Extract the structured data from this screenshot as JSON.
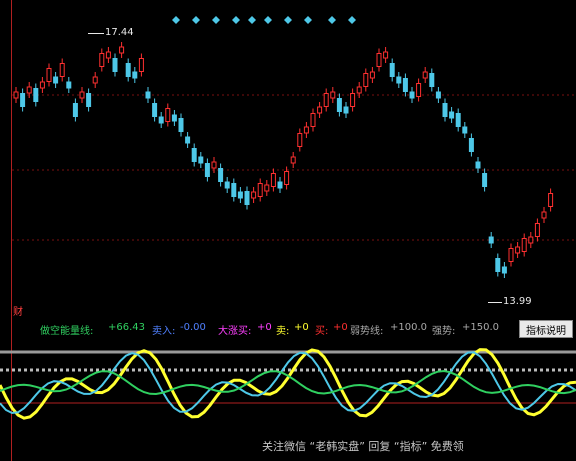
{
  "price_chart": {
    "high_label": "17.44",
    "low_label": "13.99",
    "colors": {
      "up": "#ff3030",
      "down": "#4ec8e8",
      "marker": "#4ec8e8"
    }
  },
  "indicator_legend": {
    "long_short_energy": {
      "label": "做空能量线:",
      "value": "+66.43",
      "color": "#30d060"
    },
    "sell_a": {
      "label": "卖入:",
      "value": "-0.00",
      "color": "#5080ff"
    },
    "surge_buy": {
      "label": "大涨买:",
      "value": "+0",
      "color": "#ff40ff"
    },
    "sell": {
      "label": "卖:",
      "value": "+0",
      "color": "#ffff30"
    },
    "buy": {
      "label": "买:",
      "value": "+0",
      "color": "#ff3030"
    },
    "weak_line": {
      "label": "弱势线:",
      "value": "+100.0",
      "color": "#a8a8a8"
    },
    "strong_line": {
      "label": "强势:",
      "value": "+150.0",
      "color": "#a8a8a8"
    }
  },
  "buttons": {
    "indicator_help": "指标说明"
  },
  "badges": {
    "cai": "财"
  },
  "watermark": "关注微信 “老韩实盘” 回复 “指标” 免费领"
}
